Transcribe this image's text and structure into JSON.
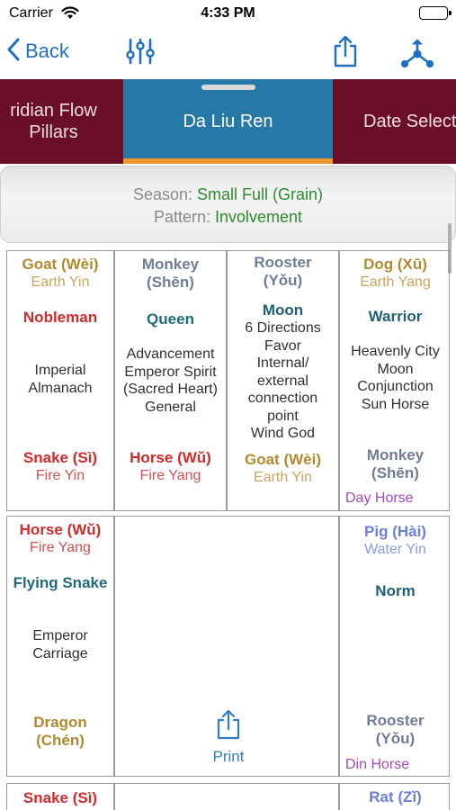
{
  "status_bar": {
    "carrier": "Carrier",
    "time": "4:33 PM"
  },
  "nav": {
    "back_label": "Back",
    "icons": [
      "sliders-icon",
      "share-icon",
      "network-icon"
    ]
  },
  "tabs": {
    "left": "ridian Flow\nPillars",
    "center": "Da Liu Ren",
    "right": "Date Select"
  },
  "season": {
    "season_label": "Season:",
    "season_value": "Small Full (Grain)",
    "pattern_label": "Pattern:",
    "pattern_value": "Involvement"
  },
  "row1": {
    "c1": {
      "branch": "Goat (Wèi)",
      "element": "Earth Yin",
      "role": "Nobleman",
      "desc": "Imperial\nAlmanach",
      "bottom_branch": "Snake (Sì)",
      "bottom_element": "Fire Yin"
    },
    "c2": {
      "branch": "Monkey\n(Shēn)",
      "role": "Queen",
      "desc": "Advancement\nEmperor Spirit\n(Sacred Heart)\nGeneral",
      "bottom_branch": "Horse (Wǔ)",
      "bottom_element": "Fire Yang"
    },
    "c3": {
      "branch": "Rooster\n(Yǒu)",
      "role": "Moon",
      "desc": "6 Directions\nFavor\nInternal/\nexternal\nconnection\npoint\nWind God",
      "bottom_branch": "Goat (Wèi)",
      "bottom_element": "Earth Yin"
    },
    "c4": {
      "branch": "Dog (Xū)",
      "element": "Earth Yang",
      "role": "Warrior",
      "desc": "Heavenly City\nMoon\nConjunction\nSun Horse",
      "bottom_branch": "Monkey\n(Shēn)",
      "tag": "Day Horse"
    }
  },
  "row2": {
    "c1": {
      "branch": "Horse (Wǔ)",
      "element": "Fire Yang",
      "role": "Flying Snake",
      "desc": "Emperor\nCarriage",
      "bottom_branch": "Dragon\n(Chén)"
    },
    "print_label": "Print",
    "c4": {
      "branch": "Pig (Hài)",
      "element": "Water Yin",
      "role": "Norm",
      "bottom_branch": "Rooster\n(Yǒu)",
      "tag": "Din Horse"
    }
  },
  "row3": {
    "c1_branch": "Snake (Sì)",
    "c4_branch": "Rat (Zǐ)"
  }
}
